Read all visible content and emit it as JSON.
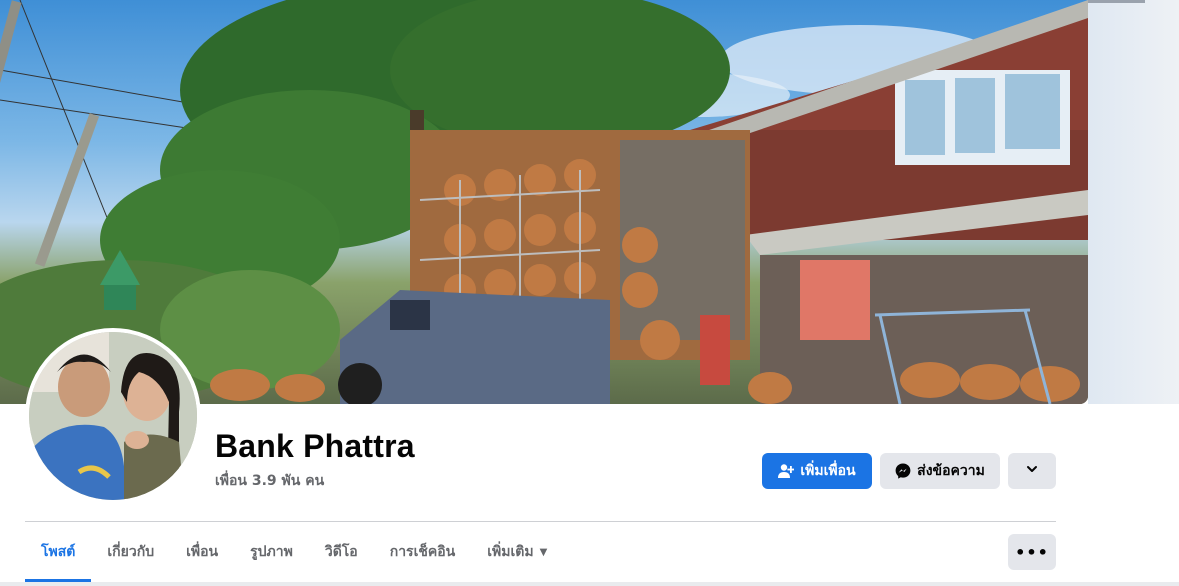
{
  "profile": {
    "name": "Bank Phattra",
    "friend_count": "เพื่อน 3.9 พัน คน"
  },
  "actions": {
    "add_friend_label": "เพิ่มเพื่อน",
    "message_label": "ส่งข้อความ",
    "more_icon": "chevron-down-icon"
  },
  "tabs": [
    {
      "label": "โพสต์",
      "active": true
    },
    {
      "label": "เกี่ยวกับ",
      "active": false
    },
    {
      "label": "เพื่อน",
      "active": false
    },
    {
      "label": "รูปภาพ",
      "active": false
    },
    {
      "label": "วิดีโอ",
      "active": false
    },
    {
      "label": "การเช็คอิน",
      "active": false
    },
    {
      "label": "เพิ่มเติม",
      "active": false
    }
  ],
  "tab_more_label": "•••",
  "colors": {
    "accent": "#1b74e4",
    "secondary_button": "#e4e6eb",
    "muted_text": "#65676b"
  }
}
